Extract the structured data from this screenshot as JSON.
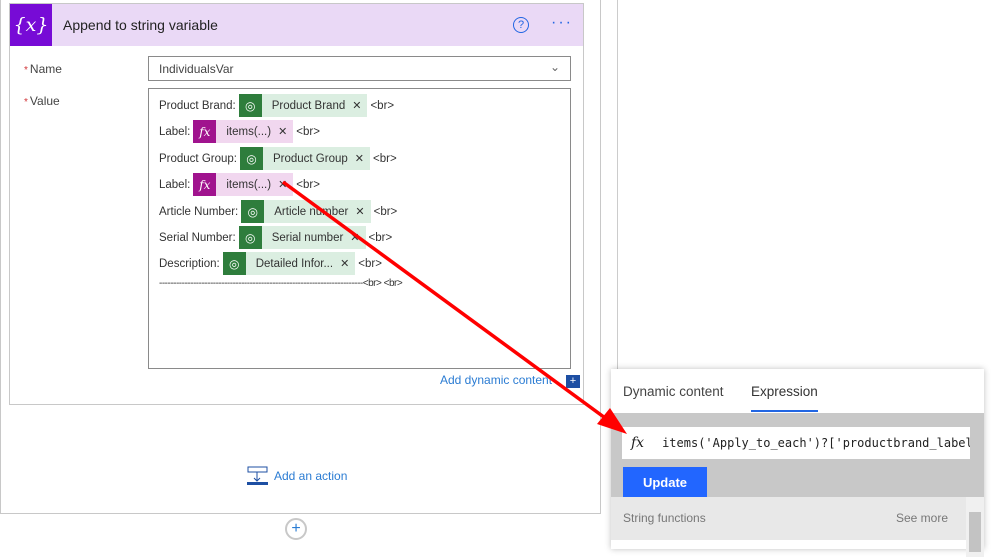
{
  "card": {
    "title": "Append to string variable",
    "icon": "{x}",
    "help": "?",
    "more": "···"
  },
  "name_field": {
    "label": "Name",
    "value": "IndividualsVar"
  },
  "value_field": {
    "label": "Value",
    "rows": [
      {
        "label": "Product Brand:",
        "token": "Product Brand",
        "type": "dynamic",
        "suffix": "<br>"
      },
      {
        "label": "Label:",
        "token": "items(...)",
        "type": "expression",
        "suffix": "<br>"
      },
      {
        "label": "Product Group:",
        "token": "Product Group",
        "type": "dynamic",
        "suffix": "<br>"
      },
      {
        "label": "Label:",
        "token": "items(...)",
        "type": "expression",
        "suffix": "<br>"
      },
      {
        "label": "Article Number:",
        "token": "Article number",
        "type": "dynamic",
        "suffix": "<br>"
      },
      {
        "label": "Serial Number:",
        "token": "Serial number",
        "type": "dynamic",
        "suffix": "<br>"
      },
      {
        "label": "Description:",
        "token": "Detailed Infor...",
        "type": "dynamic",
        "suffix": "<br>"
      }
    ],
    "separator": "------------------------------------------------------------------------<br> <br>"
  },
  "add_dynamic_content": "Add dynamic content",
  "add_action": "Add an action",
  "panel": {
    "tabs": [
      "Dynamic content",
      "Expression"
    ],
    "active_tab": "Expression",
    "expression": "items('Apply_to_each')?['productbrand_label",
    "update": "Update",
    "section": "String functions",
    "see_more": "See more"
  },
  "colors": {
    "variable": "#770bd6",
    "dynamic": "#2e7d3c",
    "expression": "#a0138e",
    "link": "#2b7cd3",
    "arrow": "#ff0000"
  }
}
